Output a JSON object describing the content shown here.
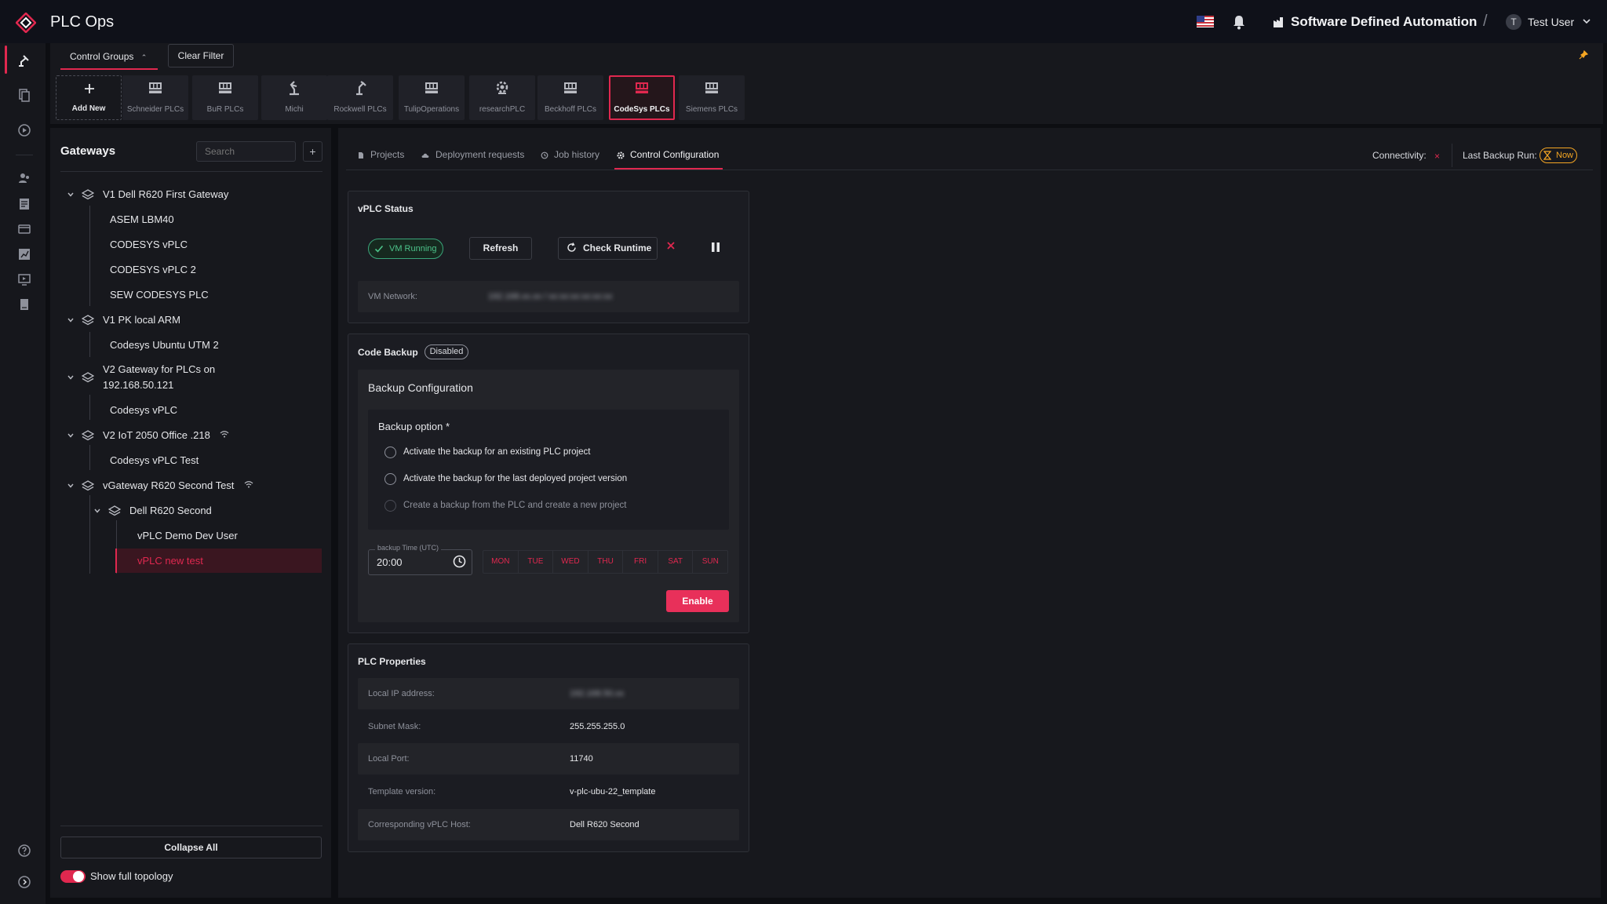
{
  "app": {
    "title": "PLC Ops",
    "context_title": "Software Defined Automation",
    "separator": "/"
  },
  "user": {
    "name": "Test User",
    "initial": "T"
  },
  "colors": {
    "accent": "#e0284f",
    "success": "#4cc38a",
    "warning": "#f5a623",
    "background": "#0d0e12",
    "panel": "#17181d"
  },
  "toolbar": {
    "group_tab_label": "Control Groups",
    "clear_filter_label": "Clear Filter",
    "add_new_label": "Add New",
    "groups": [
      {
        "label": "Schneider PLCs",
        "icon": "plc-icon"
      },
      {
        "label": "BuR PLCs",
        "icon": "plc-icon"
      },
      {
        "label": "Michi",
        "icon": "robot-arm-icon"
      },
      {
        "label": "Rockwell PLCs",
        "icon": "robot-arm-icon"
      },
      {
        "label": "TulipOperations",
        "icon": "plc-icon"
      },
      {
        "label": "researchPLC",
        "icon": "gear-cluster-icon"
      },
      {
        "label": "Beckhoff PLCs",
        "icon": "plc-icon"
      },
      {
        "label": "CodeSys PLCs",
        "icon": "plc-icon",
        "selected": true
      },
      {
        "label": "Siemens PLCs",
        "icon": "plc-icon"
      }
    ]
  },
  "gateways": {
    "title": "Gateways",
    "search_placeholder": "Search",
    "add_label": "+",
    "tree": {
      "g1": {
        "label": "V1 Dell R620 First Gateway",
        "children": [
          "ASEM LBM40",
          "CODESYS vPLC",
          "CODESYS vPLC 2",
          "SEW CODESYS PLC"
        ]
      },
      "g2": {
        "label": "V1 PK local ARM",
        "children": [
          "Codesys Ubuntu UTM 2"
        ]
      },
      "g3": {
        "label_line1": "V2 Gateway for PLCs on",
        "label_line2": "192.168.50.121",
        "children": [
          "Codesys vPLC"
        ]
      },
      "g4": {
        "label": "V2 IoT 2050 Office .218",
        "children": [
          "Codesys vPLC Test"
        ]
      },
      "g5": {
        "label": "vGateway R620 Second Test",
        "sub": {
          "label": "Dell R620 Second",
          "children": [
            "vPLC Demo Dev User",
            "vPLC new test"
          ]
        }
      }
    },
    "collapse_all_label": "Collapse All",
    "show_topology_label": "Show full topology"
  },
  "main": {
    "tabs": [
      {
        "label": "Projects"
      },
      {
        "label": "Deployment requests"
      },
      {
        "label": "Job history"
      },
      {
        "label": "Control Configuration",
        "active": true
      }
    ],
    "connectivity_label": "Connectivity:",
    "connectivity_status": "×",
    "last_backup_label": "Last Backup Run:",
    "last_backup_value": "Now"
  },
  "vplc_status": {
    "title": "vPLC Status",
    "vm_state": "VM Running",
    "refresh_label": "Refresh",
    "check_runtime_label": "Check Runtime",
    "vm_network_label": "VM Network:",
    "vm_network_value": "192.168.xx.xx / xx:xx:xx:xx:xx:xx"
  },
  "code_backup": {
    "title": "Code Backup",
    "status_badge": "Disabled",
    "config_title": "Backup Configuration",
    "option_label": "Backup option *",
    "options": [
      {
        "label": "Activate the backup for an existing PLC project",
        "enabled": true
      },
      {
        "label": "Activate the backup for the last deployed project version",
        "enabled": true
      },
      {
        "label": "Create a backup from the PLC and create a new project",
        "enabled": false
      }
    ],
    "time_label": "backup Time (UTC)",
    "time_value": "20:00",
    "days": [
      "MON",
      "TUE",
      "WED",
      "THU",
      "FRI",
      "SAT",
      "SUN"
    ],
    "enable_label": "Enable"
  },
  "plc_properties": {
    "title": "PLC Properties",
    "rows": [
      {
        "label": "Local IP address:",
        "value": "192.168.50.xx"
      },
      {
        "label": "Subnet Mask:",
        "value": "255.255.255.0"
      },
      {
        "label": "Local Port:",
        "value": "11740"
      },
      {
        "label": "Template version:",
        "value": "v-plc-ubu-22_template"
      },
      {
        "label": "Corresponding vPLC Host:",
        "value": "Dell R620 Second"
      }
    ]
  }
}
